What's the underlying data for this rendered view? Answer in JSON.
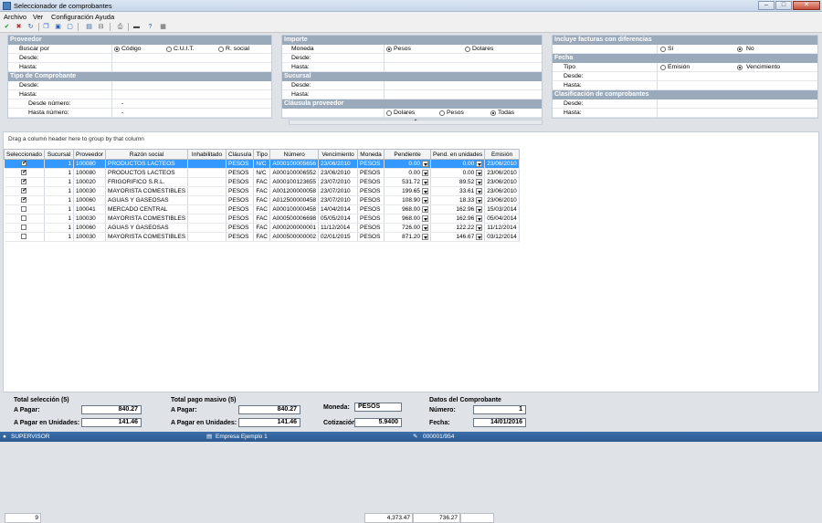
{
  "window": {
    "title": "Seleccionador de comprobantes"
  },
  "menu": [
    "Archivo",
    "Ver",
    "Configuración",
    "Ayuda"
  ],
  "proveedor": {
    "header": "Proveedor",
    "buscar_por": "Buscar por",
    "opts": [
      "Código",
      "C.U.I.T.",
      "R. social"
    ],
    "desde": "Desde:",
    "hasta": "Hasta:"
  },
  "tipo_comp": {
    "header": "Tipo de Comprobante",
    "desde": "Desde:",
    "hasta": "Hasta:",
    "desde_num": "Desde número:",
    "hasta_num": "Hasta número:",
    "dash1": "-",
    "dash2": "-"
  },
  "importe": {
    "header": "Importe",
    "moneda": "Moneda",
    "opts": [
      "Pesos",
      "Dolares"
    ],
    "desde": "Desde:",
    "hasta": "Hasta:"
  },
  "sucursal": {
    "header": "Sucursal",
    "desde": "Desde:",
    "hasta": "Hasta:"
  },
  "clausula": {
    "header": "Cláusula proveedor",
    "opts": [
      "Dolares",
      "Pesos",
      "Todas"
    ]
  },
  "incluye": {
    "header": "Incluye facturas con diferencias",
    "opts": [
      "Sí",
      "No"
    ]
  },
  "fecha": {
    "header": "Fecha",
    "tipo": "Tipo",
    "opts": [
      "Emisión",
      "Vencimiento"
    ],
    "desde": "Desde:",
    "hasta": "Hasta:"
  },
  "clasif": {
    "header": "Clasificación de comprobantes",
    "desde": "Desde:",
    "hasta": "Hasta:"
  },
  "grid": {
    "hint": "Drag a column header here to group by that column",
    "headers": [
      "Seleccionado",
      "Sucursal",
      "Proveedor",
      "Razón social",
      "Inhabilitado",
      "Cláusula",
      "Tipo",
      "Número",
      "Vencimiento",
      "Moneda",
      "Pendiente",
      "Pend. en unidades",
      "Emisión"
    ],
    "rows": [
      {
        "sel": true,
        "suc": "1",
        "prov": "100080",
        "razon": "PRODUCTOS LACTEOS",
        "inh": "",
        "cla": "PESOS",
        "tipo": "N/C",
        "num": "A000100005656",
        "venc": "23/06/2010",
        "mon": "PESOS",
        "pend": "0.00",
        "pendu": "0.00",
        "emi": "23/06/2010"
      },
      {
        "sel": true,
        "suc": "1",
        "prov": "100080",
        "razon": "PRODUCTOS LACTEOS",
        "inh": "",
        "cla": "PESOS",
        "tipo": "N/C",
        "num": "A000100006552",
        "venc": "23/06/2010",
        "mon": "PESOS",
        "pend": "0.00",
        "pendu": "0.00",
        "emi": "23/06/2010"
      },
      {
        "sel": true,
        "suc": "1",
        "prov": "100020",
        "razon": "FRIGORIFICO S.R.L.",
        "inh": "",
        "cla": "PESOS",
        "tipo": "FAC",
        "num": "A000100123655",
        "venc": "23/07/2010",
        "mon": "PESOS",
        "pend": "531.72",
        "pendu": "89.52",
        "emi": "23/06/2010"
      },
      {
        "sel": true,
        "suc": "1",
        "prov": "100030",
        "razon": "MAYORISTA COMESTIBLES",
        "inh": "",
        "cla": "PESOS",
        "tipo": "FAC",
        "num": "A001200000058",
        "venc": "23/07/2010",
        "mon": "PESOS",
        "pend": "199.65",
        "pendu": "33.61",
        "emi": "23/06/2010"
      },
      {
        "sel": true,
        "suc": "1",
        "prov": "100060",
        "razon": "AGUAS Y GASEOSAS",
        "inh": "",
        "cla": "PESOS",
        "tipo": "FAC",
        "num": "A012500000458",
        "venc": "23/07/2010",
        "mon": "PESOS",
        "pend": "108.90",
        "pendu": "18.33",
        "emi": "23/06/2010"
      },
      {
        "sel": false,
        "suc": "1",
        "prov": "100041",
        "razon": "MERCADO CENTRAL",
        "inh": "",
        "cla": "PESOS",
        "tipo": "FAC",
        "num": "A000100000458",
        "venc": "14/04/2014",
        "mon": "PESOS",
        "pend": "968.00",
        "pendu": "162.96",
        "emi": "15/03/2014"
      },
      {
        "sel": false,
        "suc": "1",
        "prov": "100030",
        "razon": "MAYORISTA COMESTIBLES",
        "inh": "",
        "cla": "PESOS",
        "tipo": "FAC",
        "num": "A000500006698",
        "venc": "05/05/2014",
        "mon": "PESOS",
        "pend": "968.00",
        "pendu": "162.96",
        "emi": "05/04/2014"
      },
      {
        "sel": false,
        "suc": "1",
        "prov": "100060",
        "razon": "AGUAS Y GASEOSAS",
        "inh": "",
        "cla": "PESOS",
        "tipo": "FAC",
        "num": "A000200000001",
        "venc": "11/12/2014",
        "mon": "PESOS",
        "pend": "726.00",
        "pendu": "122.22",
        "emi": "11/12/2014"
      },
      {
        "sel": false,
        "suc": "1",
        "prov": "100030",
        "razon": "MAYORISTA COMESTIBLES",
        "inh": "",
        "cla": "PESOS",
        "tipo": "FAC",
        "num": "A000500000002",
        "venc": "02/01/2015",
        "mon": "PESOS",
        "pend": "871.20",
        "pendu": "146.67",
        "emi": "03/12/2014"
      }
    ],
    "footer": {
      "count": "9",
      "pend_total": "4,373.47",
      "pendu_total": "736.27"
    }
  },
  "summary": {
    "total_sel_label": "Total selección (5)",
    "a_pagar_label": "A Pagar:",
    "a_pagar": "840.27",
    "a_pagar_u_label": "A Pagar en Unidades:",
    "a_pagar_u": "141.46",
    "total_masivo_label": "Total pago masivo (5)",
    "m_a_pagar_label": "A Pagar:",
    "m_a_pagar": "840.27",
    "m_a_pagar_u_label": "A Pagar en Unidades:",
    "m_a_pagar_u": "141.46",
    "moneda_label": "Moneda:",
    "moneda": "PESOS",
    "cotiz_label": "Cotización:",
    "cotiz": "5.9400",
    "datos_label": "Datos del Comprobante",
    "numero_label": "Número:",
    "numero": "1",
    "fecha_label": "Fecha:",
    "fecha": "14/01/2016"
  },
  "status": {
    "user": "SUPERVISOR",
    "empresa": "Empresa Ejemplo 1",
    "doc": "000001/954"
  },
  "colors": {
    "section": "#9aaabb",
    "selected_row": "#3399ff",
    "statusbar": "#2c5a92"
  }
}
